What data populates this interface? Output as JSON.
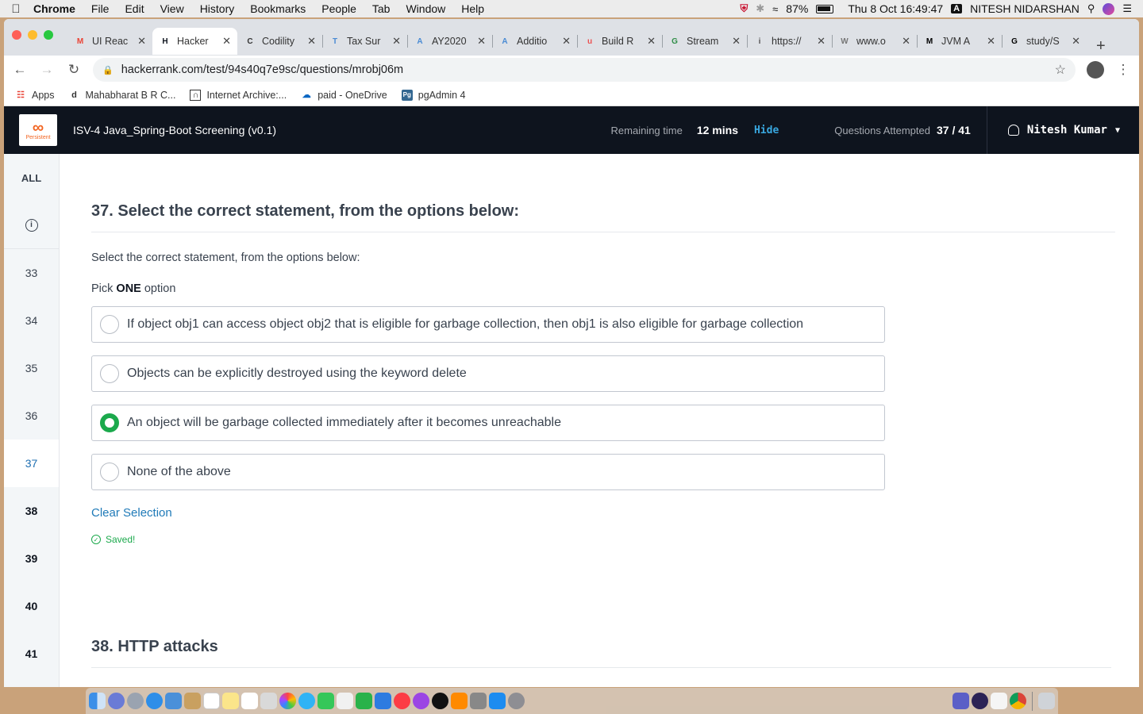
{
  "menubar": {
    "app": "Chrome",
    "items": [
      "File",
      "Edit",
      "View",
      "History",
      "Bookmarks",
      "People",
      "Tab",
      "Window",
      "Help"
    ],
    "battery": "87%",
    "datetime": "Thu 8 Oct  16:49:47",
    "input_source": "A",
    "user": "NITESH NIDARSHAN"
  },
  "tabs": [
    {
      "title": "UI Reac",
      "icon": "gmail-icon",
      "color": "#ea4335",
      "glyph": "M"
    },
    {
      "title": "Hacker",
      "icon": "hackerrank-icon",
      "color": "#0e141e",
      "glyph": "H",
      "active": true
    },
    {
      "title": "Codility",
      "icon": "codility-icon",
      "color": "#333333",
      "glyph": "C"
    },
    {
      "title": "Tax Sur",
      "icon": "tax-icon",
      "color": "#4a8bd4",
      "glyph": "T"
    },
    {
      "title": "AY2020",
      "icon": "tax-icon",
      "color": "#4a8bd4",
      "glyph": "A"
    },
    {
      "title": "Additio",
      "icon": "tax-icon",
      "color": "#4a8bd4",
      "glyph": "A"
    },
    {
      "title": "Build R",
      "icon": "udemy-icon",
      "color": "#ec5252",
      "glyph": "u"
    },
    {
      "title": "Stream",
      "icon": "gfg-icon",
      "color": "#2f8d46",
      "glyph": "G"
    },
    {
      "title": "https://",
      "icon": "page-icon",
      "color": "#555555",
      "glyph": "i"
    },
    {
      "title": "www.o",
      "icon": "page-icon",
      "color": "#777777",
      "glyph": "W"
    },
    {
      "title": "JVM A",
      "icon": "medium-icon",
      "color": "#000000",
      "glyph": "M"
    },
    {
      "title": "study/S",
      "icon": "github-icon",
      "color": "#000000",
      "glyph": "G"
    }
  ],
  "toolbar": {
    "url": "hackerrank.com/test/94s40q7e9sc/questions/mrobj06m"
  },
  "bookmarks": [
    {
      "label": "Apps",
      "icon": "apps-grid-icon"
    },
    {
      "label": "Mahabharat B R C...",
      "icon": "d-icon"
    },
    {
      "label": "Internet Archive:...",
      "icon": "archive-icon"
    },
    {
      "label": "paid - OneDrive",
      "icon": "onedrive-icon"
    },
    {
      "label": "pgAdmin 4",
      "icon": "pgadmin-icon"
    }
  ],
  "header": {
    "logo_text": "Persistent",
    "test_name": "ISV-4 Java_Spring-Boot Screening (v0.1)",
    "remaining_label": "Remaining time",
    "remaining_value": "12 mins",
    "hide_label": "Hide",
    "attempted_label": "Questions Attempted",
    "attempted_value": "37 / 41",
    "user_name": "Nitesh Kumar"
  },
  "sidebar": {
    "all_label": "ALL",
    "questions": [
      {
        "num": "33",
        "state": "answered"
      },
      {
        "num": "34",
        "state": "answered"
      },
      {
        "num": "35",
        "state": "answered"
      },
      {
        "num": "36",
        "state": "answered"
      },
      {
        "num": "37",
        "state": "current"
      },
      {
        "num": "38",
        "state": "unanswered"
      },
      {
        "num": "39",
        "state": "unanswered"
      },
      {
        "num": "40",
        "state": "unanswered"
      },
      {
        "num": "41",
        "state": "unanswered"
      }
    ]
  },
  "question": {
    "title": "37. Select the correct statement, from the options below:",
    "text": "Select the correct statement, from the options below:",
    "pick_prefix": "Pick ",
    "pick_bold": "ONE",
    "pick_suffix": " option",
    "options": [
      {
        "text": "If object obj1 can access object obj2 that is eligible for garbage collection, then obj1 is also eligible for garbage collection",
        "selected": false
      },
      {
        "text": "Objects can be explicitly destroyed using the keyword delete",
        "selected": false
      },
      {
        "text": "An object will be garbage collected immediately after it becomes unreachable",
        "selected": true
      },
      {
        "text": "None of the above",
        "selected": false
      }
    ],
    "clear_label": "Clear Selection",
    "saved_label": "Saved!"
  },
  "next_question": {
    "title": "38. HTTP attacks"
  },
  "colors": {
    "accent_green": "#1ba94c",
    "link_blue": "#1f7ab8",
    "header_bg": "#0e141e"
  }
}
